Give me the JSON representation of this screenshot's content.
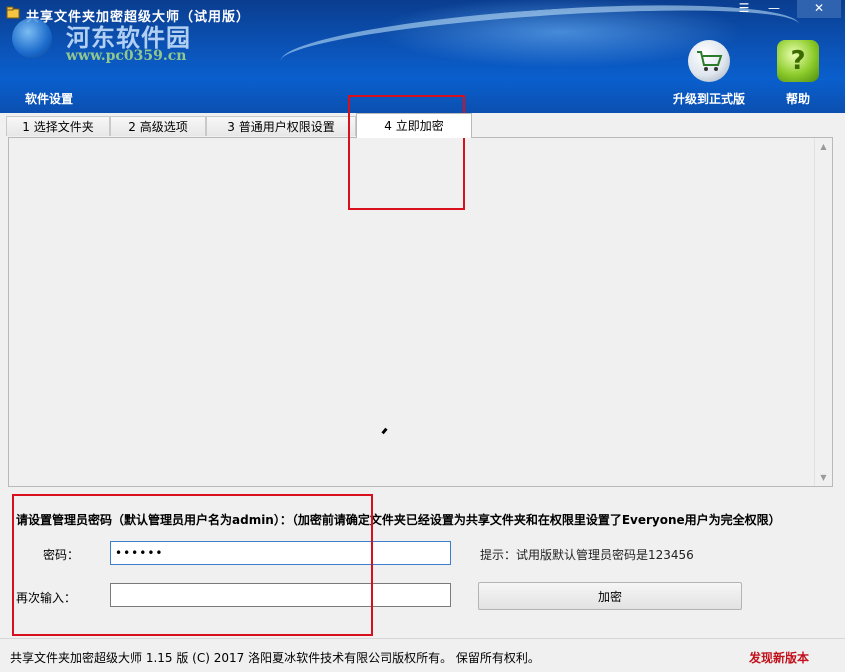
{
  "window": {
    "title": "共享文件夹加密超级大师（试用版）",
    "controls": {
      "menu": "☰",
      "minimize": "—",
      "close": "✕"
    }
  },
  "watermark": {
    "name": "河东软件园",
    "url": "www.pc0359.cn"
  },
  "toolbar": {
    "settings_label": "软件设置",
    "upgrade_label": "升级到正式版",
    "help_label": "帮助",
    "help_glyph": "?"
  },
  "tabs": [
    {
      "label": "1 选择文件夹",
      "selected": false
    },
    {
      "label": "2 高级选项",
      "selected": false
    },
    {
      "label": "3 普通用户权限设置",
      "selected": false
    },
    {
      "label": "4 立即加密",
      "selected": true
    }
  ],
  "form": {
    "notice": "请设置管理员密码（默认管理员用户名为admin）：（加密前请确定文件夹已经设置为共享文件夹和在权限里设置了Everyone用户为完全权限）",
    "password_label": "密码：",
    "password_value": "123456",
    "repeat_label": "再次输入：",
    "repeat_value": "",
    "hint": "提示：试用版默认管理员密码是123456",
    "encrypt_label": "加密"
  },
  "status": {
    "copyright": "共享文件夹加密超级大师 1.15 版 (C) 2017 洛阳夏冰软件技术有限公司版权所有。 保留所有权利。",
    "new_version": "发现新版本"
  },
  "colors": {
    "title_bar": "#0b54b9",
    "annotation": "#d8101e",
    "new_version": "#c1121c"
  }
}
